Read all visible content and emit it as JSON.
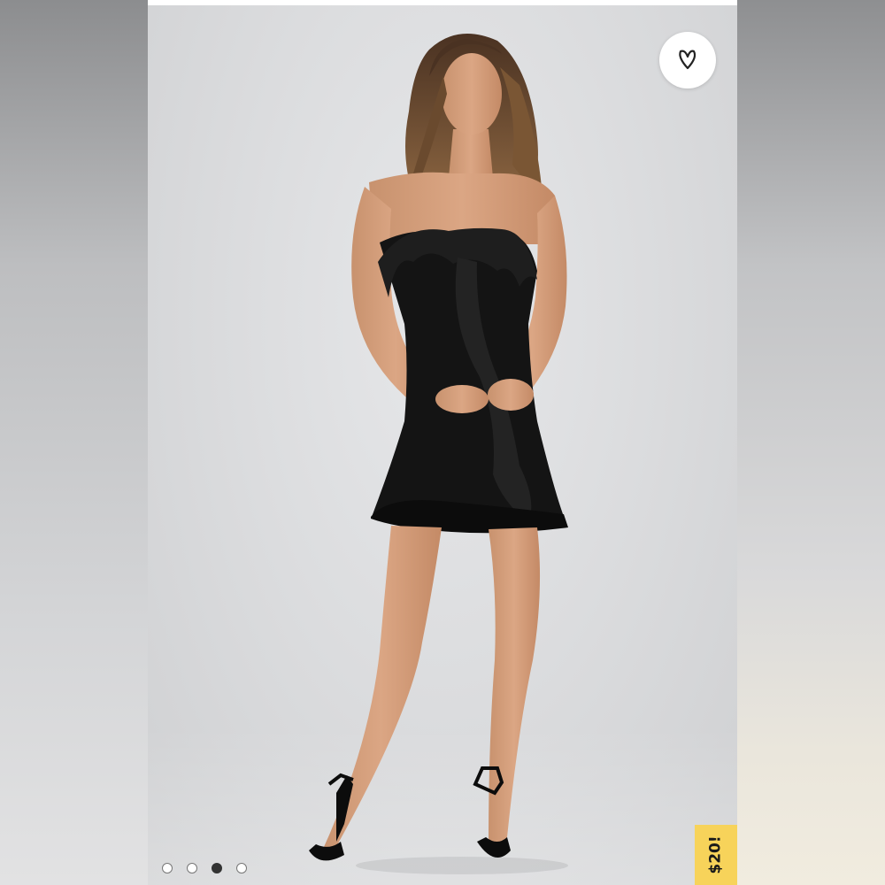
{
  "listing": {
    "price_tag": "$20!",
    "like_icon": "heart-icon",
    "carousel": {
      "count": 4,
      "active_index": 2
    }
  },
  "colors": {
    "price_tag_bg": "#f7d35a",
    "dress": "#141414",
    "backdrop": "#dcdddf"
  }
}
